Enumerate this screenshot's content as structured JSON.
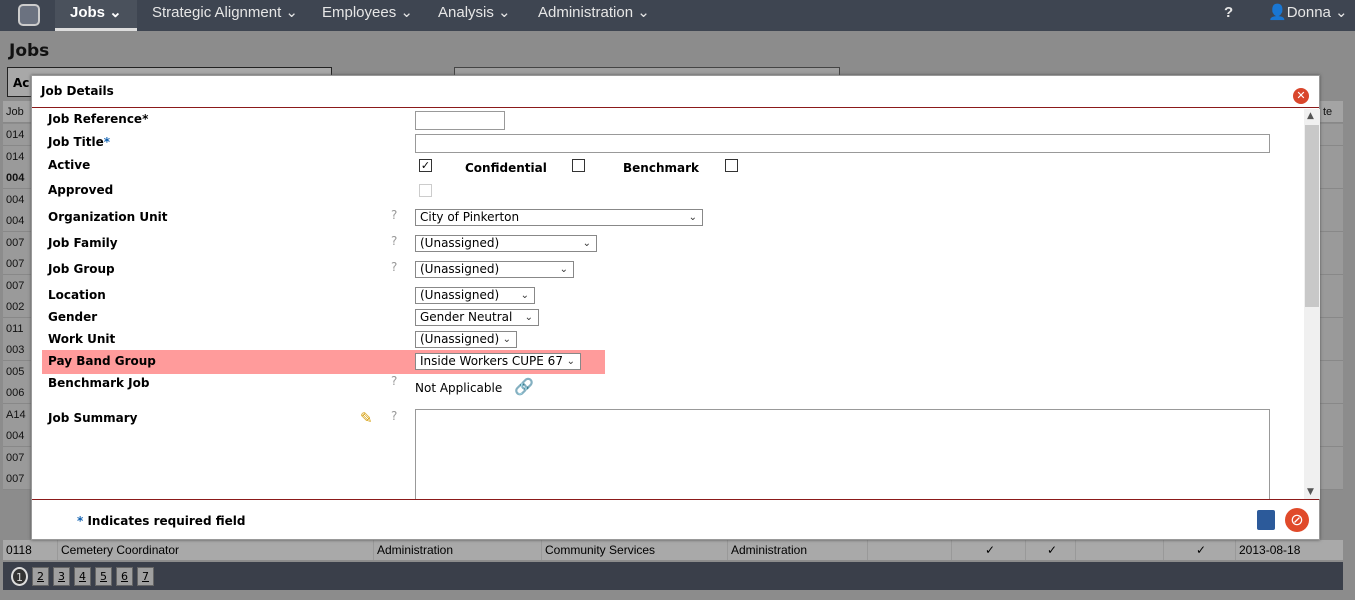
{
  "nav": {
    "items": [
      {
        "label": "Jobs"
      },
      {
        "label": "Strategic Alignment"
      },
      {
        "label": "Employees"
      },
      {
        "label": "Analysis"
      },
      {
        "label": "Administration"
      }
    ],
    "user": "Donna"
  },
  "page": {
    "title": "Jobs",
    "toolbar_label": "Ac",
    "table_header_left": "Job",
    "table_header_right": "te"
  },
  "bg_rows": [
    "014",
    "014",
    "004",
    "004",
    "004",
    "007",
    "007",
    "007",
    "002",
    "011",
    "003",
    "005",
    "006",
    "A14",
    "004",
    "007",
    "007"
  ],
  "last_row": {
    "code": "0118",
    "title": "Cemetery Coordinator",
    "family": "Administration",
    "org": "Community Services",
    "group": "Administration",
    "check1": "✓",
    "check2": "✓",
    "check3": "✓",
    "date": "2013-08-18"
  },
  "pager": [
    "1",
    "2",
    "3",
    "4",
    "5",
    "6",
    "7"
  ],
  "modal": {
    "title": "Job Details",
    "fields": {
      "job_reference": "Job Reference",
      "job_title": "Job Title",
      "active": "Active",
      "confidential": "Confidential",
      "benchmark": "Benchmark",
      "approved": "Approved",
      "org_unit": "Organization Unit",
      "job_family": "Job Family",
      "job_group": "Job Group",
      "location": "Location",
      "gender": "Gender",
      "work_unit": "Work Unit",
      "pay_band_group": "Pay Band Group",
      "benchmark_job": "Benchmark Job",
      "job_summary": "Job Summary"
    },
    "values": {
      "job_reference": "",
      "job_title": "",
      "active": true,
      "confidential": false,
      "benchmark": false,
      "approved": false,
      "org_unit": "City of Pinkerton",
      "job_family": "(Unassigned)",
      "job_group": "(Unassigned)",
      "location": "(Unassigned)",
      "gender": "Gender Neutral",
      "work_unit": "(Unassigned)",
      "pay_band_group": "Inside Workers CUPE 67",
      "benchmark_job": "Not Applicable",
      "job_summary": ""
    },
    "required_mark": "*",
    "footer_note": "Indicates required field",
    "highlight_color": "#ff9b9b"
  }
}
